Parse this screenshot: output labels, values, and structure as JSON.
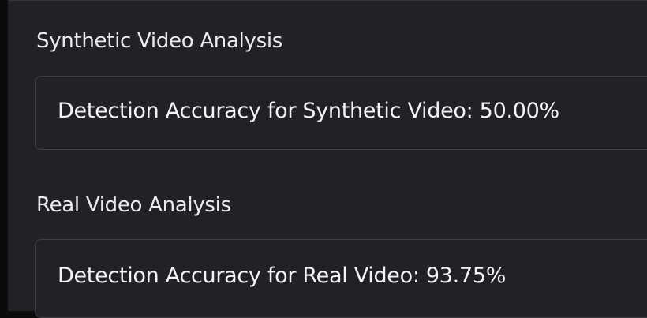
{
  "sections": [
    {
      "label": "Synthetic Video Analysis",
      "result": "Detection Accuracy for Synthetic Video: 50.00%"
    },
    {
      "label": "Real Video Analysis",
      "result": "Detection Accuracy for Real Video: 93.75%"
    }
  ],
  "colors": {
    "background": "#212126",
    "outer_background": "#0b0b0b",
    "border": "#3f3f46",
    "text": "#f4f4f6"
  }
}
